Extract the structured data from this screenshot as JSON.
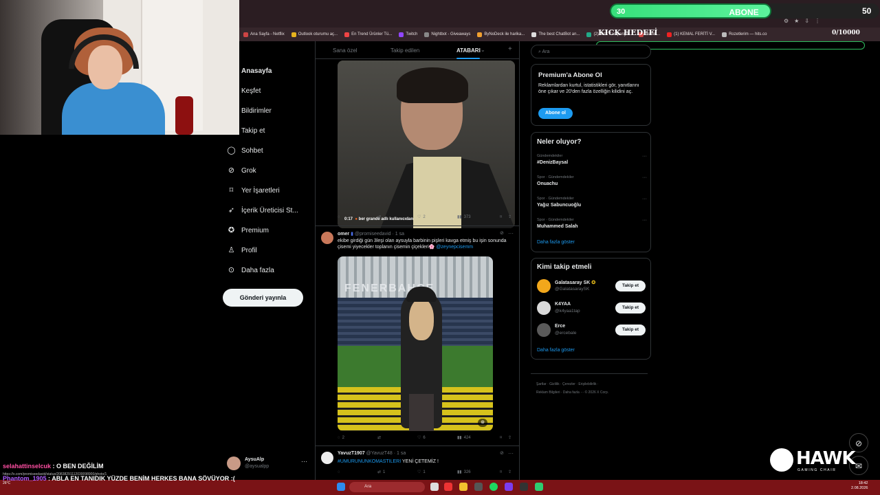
{
  "overlay": {
    "sub_current": "30",
    "sub_label": "ABONE",
    "sub_target": "50",
    "sub_progress": 0.6,
    "kick_label": "KICK HEDEFİ",
    "kick_count": "0/10000"
  },
  "browser": {
    "bookmarks": [
      "Ana Sayfa - Netflix",
      "Outlook oturumu aç...",
      "En Trend Ürünler Tü...",
      "Twitch",
      "Nightbot - Giveaways",
      "ByNoDeck ile harika...",
      "The best ChatBot an...",
      "(2) Aktif Kampanya...",
      "Harek...",
      "(1) KEMAL FERİTİ V...",
      "Rozetlerim — hits.co"
    ]
  },
  "nav": {
    "items": [
      "Anasayfa",
      "Keşfet",
      "Bildirimler",
      "Takip et",
      "Sohbet",
      "Grok",
      "Yer İşaretleri",
      "İçerik Üreticisi St...",
      "Premium",
      "Profil",
      "Daha fazla"
    ],
    "post_button": "Gönderi yayınla",
    "account_name": "AysuAlp",
    "account_handle": "@aysualpp"
  },
  "feed": {
    "tabs": [
      "Sana özel",
      "Takip edilen",
      "ATABARI"
    ],
    "video_time": "0:17",
    "video_caption": "ber grande adlı kullanıcıdan",
    "video_actions": {
      "likes": "2",
      "views": "373"
    },
    "tweet1": {
      "name": "omer",
      "handle": "@promiseedavid · 1 sa",
      "text": "ekibe girdiği gün 3leşi olan aysuyla barbinin pişleri kavga etmiş bu işin sonunda çisemi yiyecekler toplanın çisemin çiçekleri🌸",
      "mention": "@zeynepcisemm",
      "replies": "2",
      "likes": "6",
      "views": "424"
    },
    "tweet2": {
      "name": "YavuzT1907",
      "handle": "@YavuzT48 · 1 sa",
      "hashtag": "#UMURUNUNKOMASTILERI",
      "text": "YENİ ÇETEMİZ !",
      "retweets": "1",
      "likes": "1",
      "views": "326"
    }
  },
  "right": {
    "search_placeholder": "Ara",
    "premium_title": "Premium'a Abone Ol",
    "premium_desc": "Reklamlardan kurtul, istatistikleri gör, yanıtlarını öne çıkar ve 20'den fazla özelliğin kilidini aç.",
    "premium_button": "Abone ol",
    "trends_title": "Neler oluyor?",
    "trends": [
      {
        "category": "Gündemdekiler",
        "name": "#DenizBaysal"
      },
      {
        "category": "Spor · Gündemdekiler",
        "name": "Onuachu"
      },
      {
        "category": "Spor · Gündemdekiler",
        "name": "Yağız Sabuncuoğlu"
      },
      {
        "category": "Spor · Gündemdekiler",
        "name": "Muhammed Salah"
      }
    ],
    "trends_more": "Daha fazla göster",
    "who_title": "Kimi takip etmeli",
    "who": [
      {
        "name": "Galatasaray SK",
        "handle": "@GalatasaraySK",
        "button": "Takip et",
        "color": "#f2a71b"
      },
      {
        "name": "K4YAA",
        "handle": "@k4yaa1tap",
        "button": "Takip et",
        "color": "#d9d9d9"
      },
      {
        "name": "Erce",
        "handle": "@ercebale",
        "button": "Takip et",
        "color": "#5a5a5a"
      }
    ],
    "who_more": "Daha fazla göster",
    "footer": [
      "Şartlar · Gizlilik · Çerezler · Erişilebilirlik ·",
      "Reklam Bilgileri · Daha fazla ··· © 2026 X Corp."
    ]
  },
  "brand": {
    "name": "HAWK",
    "sub": "GAMING CHAIR"
  },
  "chat": {
    "user1": "selahattinselcuk",
    "msg1": ": O BEN DEĞİLİM",
    "link": "https://x.com/promiseedavid/status/20838291112030098900/photo/1",
    "user2": "Phantom_1905",
    "msg2": ": ABLA EN TANIDIK YÜZDE BENİM HERKES BANA SÖVÜYOR :("
  },
  "taskbar": {
    "search": "Ara",
    "weather": "26°C",
    "time": "18:42",
    "date": "2.08.2026"
  }
}
